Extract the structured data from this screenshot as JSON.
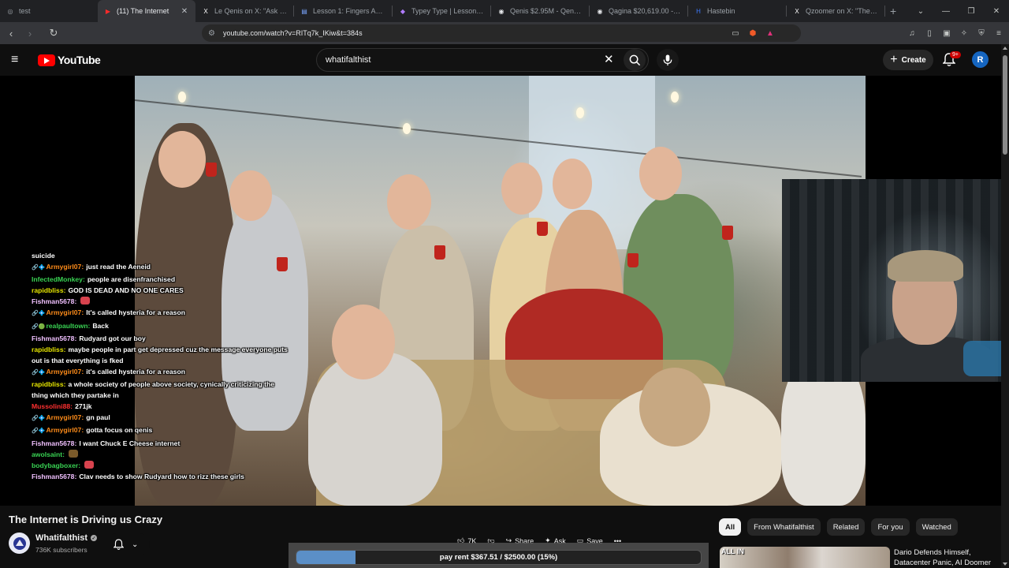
{
  "browser": {
    "tabs": [
      {
        "title": "test",
        "icon": "globe-icon"
      },
      {
        "title": "(11) The Internet",
        "icon": "youtube-icon",
        "active": true
      },
      {
        "title": "Le Qenis on X: \"Ask me a",
        "icon": "x-icon"
      },
      {
        "title": "Lesson 1: Fingers And Ke",
        "icon": "doc-icon"
      },
      {
        "title": "Typey Type | Lesson: One",
        "icon": "typey-icon"
      },
      {
        "title": "Qenis $2.95M - Qenis / S",
        "icon": "chart-icon"
      },
      {
        "title": "Qagina $20,619.00 - Qag",
        "icon": "chart-icon"
      },
      {
        "title": "Hastebin",
        "icon": "hastebin-icon"
      },
      {
        "title": "Qzoomer on X: \"The take",
        "icon": "x-icon"
      }
    ],
    "new_tab": "+",
    "url": "youtube.com/watch?v=RITq7k_IKiw&t=384s"
  },
  "youtube": {
    "logo_text": "YouTube",
    "search_value": "whatifalthist",
    "create_label": "Create",
    "notif_count": "9+",
    "avatar_letter": "R"
  },
  "chat": [
    {
      "badge": "",
      "user": "",
      "text": "suicide",
      "color": "#ffffff"
    },
    {
      "badge": "🔗💠",
      "user": "Armygirl07:",
      "text": "just read the Aeneid",
      "color": "#ff8c1a"
    },
    {
      "badge": "",
      "user": "InfectedMonkey:",
      "text": "people are disenfranchised",
      "color": "#39d353"
    },
    {
      "badge": "",
      "user": "rapidbliss:",
      "text": "GOD IS DEAD AND NO ONE CARES",
      "color": "#e5e500"
    },
    {
      "badge": "",
      "user": "Fishman5678:",
      "text": "",
      "color": "#f0c0ff",
      "emote": "#d8434e"
    },
    {
      "badge": "🔗💠",
      "user": "Armygirl07:",
      "text": "It's called hysteria for a reason",
      "color": "#ff8c1a"
    },
    {
      "badge": "🔗🟢",
      "user": "realpaultown:",
      "text": "Back",
      "color": "#39d353"
    },
    {
      "badge": "",
      "user": "Fishman5678:",
      "text": "Rudyard got our boy",
      "color": "#f0c0ff"
    },
    {
      "badge": "",
      "user": "rapidbliss:",
      "text": "maybe people in part get depressed cuz the message everyone puts",
      "color": "#e5e500"
    },
    {
      "badge": "",
      "user": "",
      "text": "out is that everything is fked",
      "color": "#ffffff"
    },
    {
      "badge": "🔗💠",
      "user": "Armygirl07:",
      "text": "it's called hysteria for a reason",
      "color": "#ff8c1a"
    },
    {
      "badge": "",
      "user": "rapidbliss:",
      "text": "a whole society of people above society, cynically criticizing the",
      "color": "#e5e500"
    },
    {
      "badge": "",
      "user": "",
      "text": "thing which they partake in",
      "color": "#ffffff"
    },
    {
      "badge": "",
      "user": "Mussolini88:",
      "text": "271jk",
      "color": "#ff3030"
    },
    {
      "badge": "🔗💠",
      "user": "Armygirl07:",
      "text": "gn paul",
      "color": "#ff8c1a"
    },
    {
      "badge": "🔗💠",
      "user": "Armygirl07:",
      "text": "gotta focus on qenis",
      "color": "#ff8c1a"
    },
    {
      "badge": "",
      "user": "Fishman5678:",
      "text": "I want Chuck E Cheese internet",
      "color": "#f0c0ff"
    },
    {
      "badge": "",
      "user": "awolsaint:",
      "text": "",
      "color": "#39d353",
      "emote": "#7b5a2a"
    },
    {
      "badge": "",
      "user": "bodybagboxer:",
      "text": "",
      "color": "#39d353",
      "emote": "#d8434e"
    },
    {
      "badge": "",
      "user": "Fishman5678:",
      "text": "Clav needs to show Rudyard how to rizz these girls",
      "color": "#f0c0ff"
    }
  ],
  "video": {
    "title": "The Internet is Driving us Crazy",
    "channel": "Whatifalthist",
    "subscribers": "736K subscribers"
  },
  "actions": {
    "likes": "7K",
    "share": "Share",
    "ask": "Ask",
    "save": "Save",
    "more": "•••"
  },
  "progress": {
    "label": "pay rent $367.51 / $2500.00 (15%)",
    "fraction": 0.147
  },
  "chips": [
    "All",
    "From Whatifalthist",
    "Related",
    "For you",
    "Watched"
  ],
  "recommendation": {
    "thumb_text": "ALL IN",
    "title": "Dario Defends Himself, Datacenter Panic, AI Doomer"
  }
}
